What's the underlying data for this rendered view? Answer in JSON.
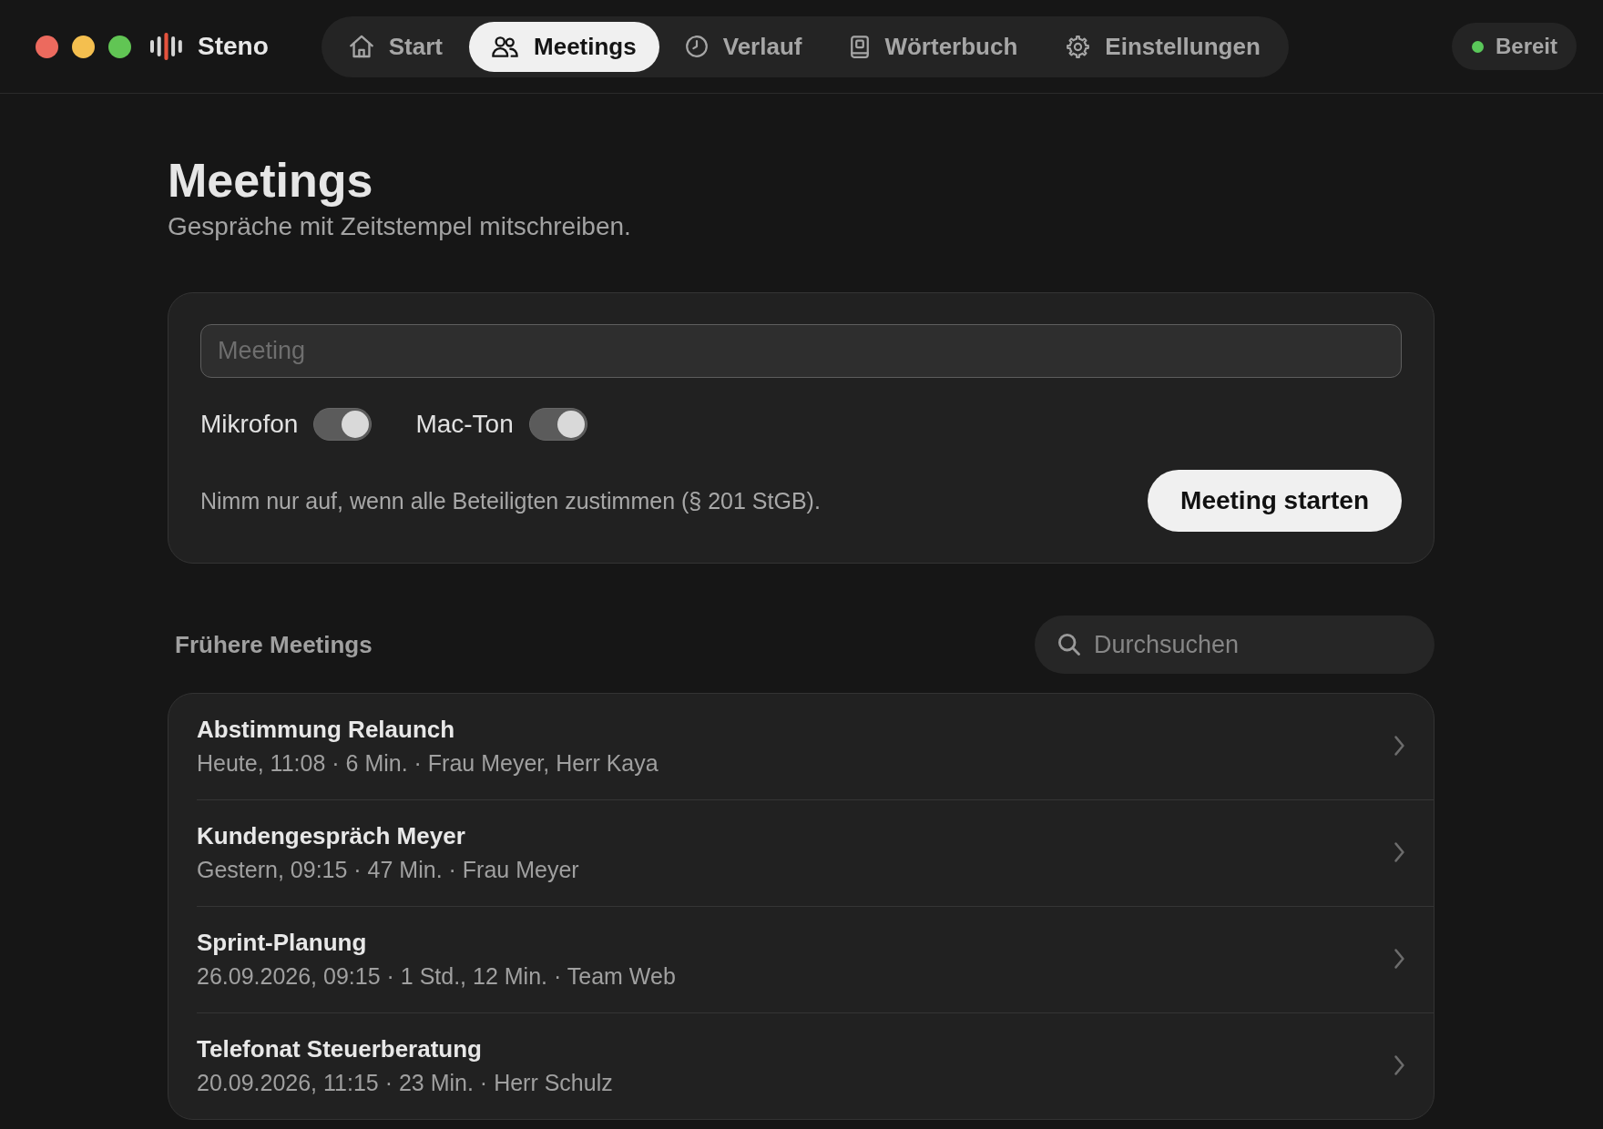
{
  "window": {
    "app_name": "Steno"
  },
  "nav": {
    "tabs": [
      {
        "label": "Start",
        "selected": false
      },
      {
        "label": "Meetings",
        "selected": true
      },
      {
        "label": "Verlauf",
        "selected": false
      },
      {
        "label": "Wörterbuch",
        "selected": false
      },
      {
        "label": "Einstellungen",
        "selected": false
      }
    ]
  },
  "status": {
    "label": "Bereit",
    "ready": true
  },
  "page": {
    "title": "Meetings",
    "subtitle": "Gespräche mit Zeitstempel mitschreiben."
  },
  "new_meeting": {
    "name_field": {
      "placeholder": "Meeting"
    },
    "toggles": [
      {
        "label": "Mikrofon",
        "on": true
      },
      {
        "label": "Mac-Ton",
        "on": true
      }
    ],
    "notice": "Nimm nur auf, wenn alle Beteiligten zustimmen (§ 201 StGB).",
    "start_button": "Meeting starten"
  },
  "past_meetings": {
    "heading": "Frühere Meetings",
    "search": {
      "placeholder": "Durchsuchen"
    },
    "items": [
      {
        "title": "Abstimmung Relaunch",
        "details": "Heute, 11:08 · 6 Min. · Frau Meyer, Herr Kaya"
      },
      {
        "title": "Kundengespräch Meyer",
        "details": "Gestern, 09:15 · 47 Min. · Frau Meyer"
      },
      {
        "title": "Sprint-Planung",
        "details": "26.09.2026, 09:15 · 1 Std., 12 Min. · Team Web"
      },
      {
        "title": "Telefonat Steuerberatung",
        "details": "20.09.2026, 11:15 · 23 Min. · Herr Schulz"
      }
    ]
  }
}
